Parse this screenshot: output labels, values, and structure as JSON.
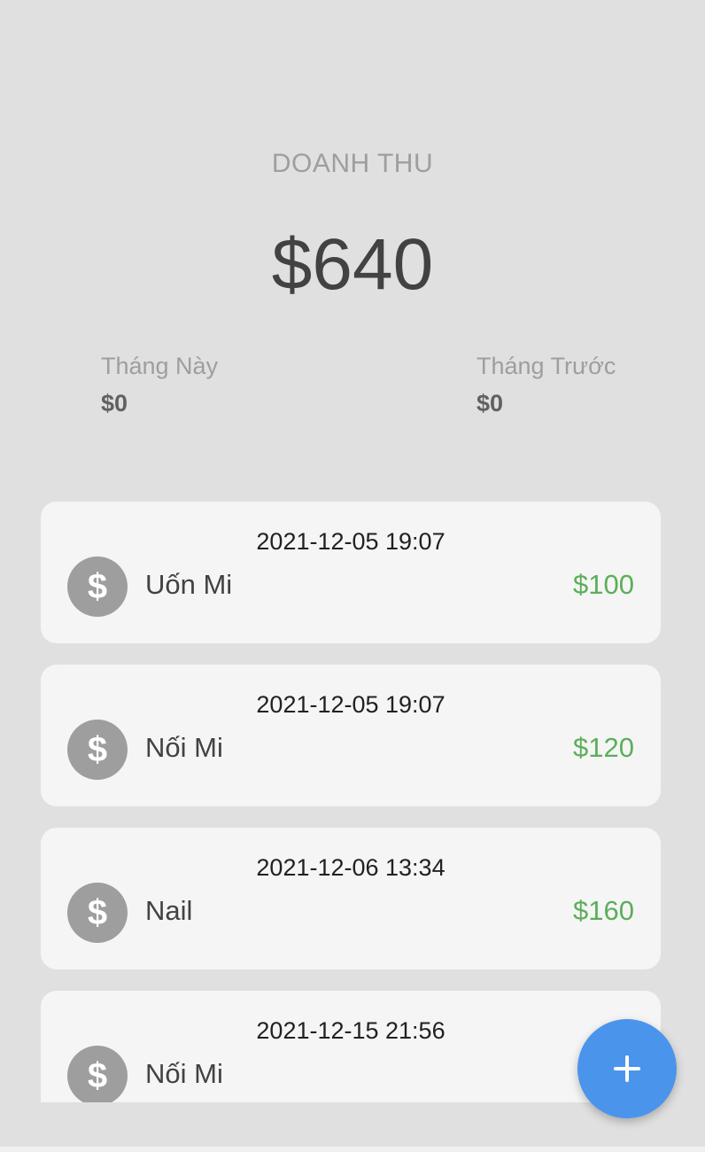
{
  "header": {
    "title": "DOANH THU",
    "total": "$640"
  },
  "stats": {
    "this_month": {
      "label": "Tháng Này",
      "value": "$0"
    },
    "last_month": {
      "label": "Tháng Trước",
      "value": "$0"
    }
  },
  "transactions": [
    {
      "date": "2021-12-05 19:07",
      "name": "Uốn Mi",
      "amount": "$100",
      "icon": "dollar-icon"
    },
    {
      "date": "2021-12-05 19:07",
      "name": "Nối Mi",
      "amount": "$120",
      "icon": "dollar-icon"
    },
    {
      "date": "2021-12-06 13:34",
      "name": "Nail",
      "amount": "$160",
      "icon": "dollar-icon"
    },
    {
      "date": "2021-12-15 21:56",
      "name": "Nối Mi",
      "amount": "$",
      "icon": "dollar-icon"
    }
  ],
  "icon_glyph": "$",
  "fab": {
    "icon": "plus-icon",
    "color": "#4a94ec"
  },
  "colors": {
    "amount_positive": "#5cae5a",
    "icon_circle": "#9e9e9e",
    "background": "#e0e0e0",
    "card": "#f5f5f5"
  }
}
